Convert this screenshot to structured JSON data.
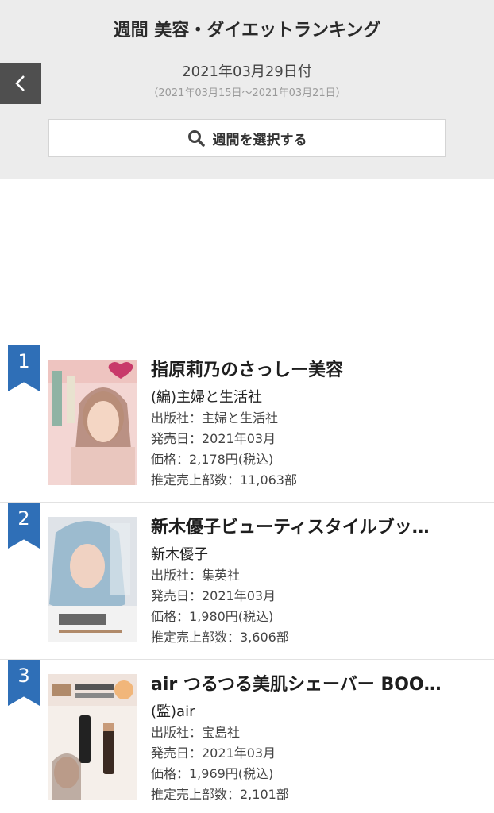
{
  "header": {
    "title": "週間 美容・ダイエットランキング",
    "date": "2021年03月29日付",
    "range": "（2021年03月15日〜2021年03月21日）",
    "select_week_label": "週間を選択する"
  },
  "icons": {
    "back": "chevron-left-icon",
    "search": "search-icon"
  },
  "colors": {
    "rank_ribbon": "#2f6fb7",
    "header_bg": "#ececec",
    "back_button": "#4f4f4f"
  },
  "ranking": [
    {
      "rank": "1",
      "title": "指原莉乃のさっしー美容",
      "author": "(編)主婦と生活社",
      "publisher": "出版社：主婦と生活社",
      "release": "発売日：2021年03月",
      "price": "価格：2,178円(税込)",
      "sales": "推定売上部数：11,063部"
    },
    {
      "rank": "2",
      "title": "新木優子ビューティスタイルブッ…",
      "author": "新木優子",
      "publisher": "出版社：集英社",
      "release": "発売日：2021年03月",
      "price": "価格：1,980円(税込)",
      "sales": "推定売上部数：3,606部"
    },
    {
      "rank": "3",
      "title": "air つるつる美肌シェーバー BOO…",
      "author": "(監)air",
      "publisher": "出版社：宝島社",
      "release": "発売日：2021年03月",
      "price": "価格：1,969円(税込)",
      "sales": "推定売上部数：2,101部"
    }
  ]
}
